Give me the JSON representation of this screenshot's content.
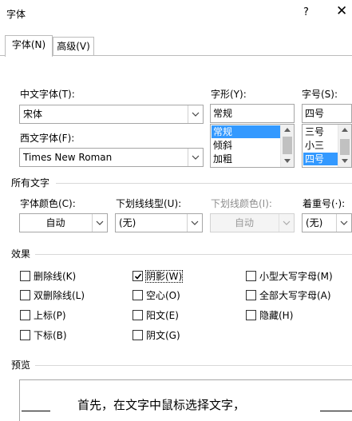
{
  "window": {
    "title": "字体",
    "help": "?",
    "close": "✕"
  },
  "tabs": [
    {
      "label": "字体(N)"
    },
    {
      "label": "高级(V)"
    }
  ],
  "font": {
    "chinese_label": "中文字体(T):",
    "chinese_value": "宋体",
    "western_label": "西文字体(F):",
    "western_value": "Times New Roman",
    "style_label": "字形(Y):",
    "style_value": "常规",
    "style_options": [
      "常规",
      "倾斜",
      "加粗"
    ],
    "size_label": "字号(S):",
    "size_value": "四号",
    "size_options": [
      "三号",
      "小三",
      "四号"
    ]
  },
  "all_text": {
    "section": "所有文字",
    "color_label": "字体颜色(C):",
    "color_value": "自动",
    "underline_label": "下划线线型(U):",
    "underline_value": "(无)",
    "underline_color_label": "下划线颜色(I):",
    "underline_color_value": "自动",
    "emphasis_label": "着重号(·):",
    "emphasis_value": "(无)"
  },
  "effects": {
    "section": "效果",
    "items": [
      {
        "label": "删除线(K)",
        "checked": false
      },
      {
        "label": "双删除线(L)",
        "checked": false
      },
      {
        "label": "上标(P)",
        "checked": false
      },
      {
        "label": "下标(B)",
        "checked": false
      },
      {
        "label": "阴影(W)",
        "checked": true
      },
      {
        "label": "空心(O)",
        "checked": false
      },
      {
        "label": "阳文(E)",
        "checked": false
      },
      {
        "label": "阴文(G)",
        "checked": false
      },
      {
        "label": "小型大写字母(M)",
        "checked": false
      },
      {
        "label": "全部大写字母(A)",
        "checked": false
      },
      {
        "label": "隐藏(H)",
        "checked": false
      }
    ]
  },
  "preview": {
    "section": "预览",
    "text": "首先，在文字中鼠标选择文字，"
  },
  "colors": {
    "selection": "#3399ff",
    "border": "#a6a6a6",
    "disabled_text": "#8d8d8d"
  }
}
